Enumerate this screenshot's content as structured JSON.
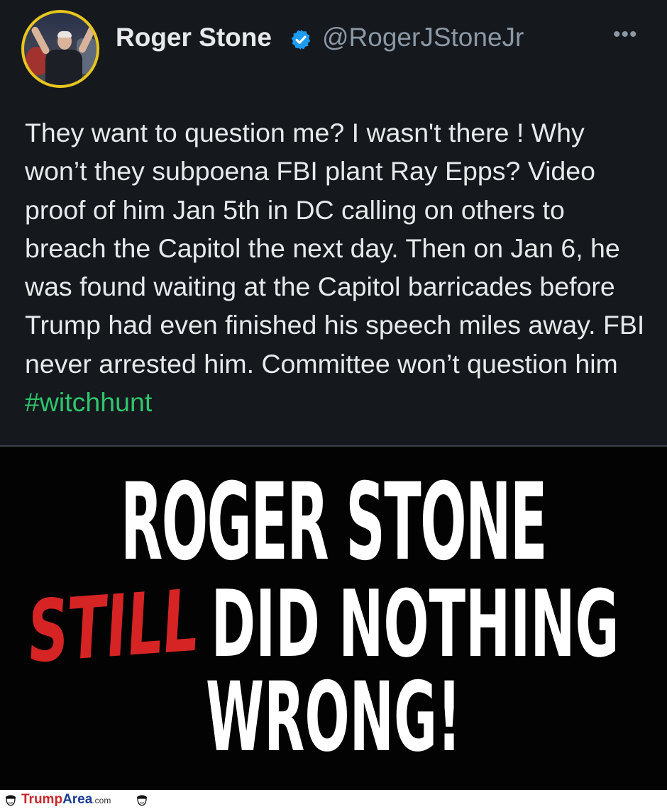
{
  "tweet": {
    "author_name": "Roger Stone",
    "handle": "@RogerJStoneJr",
    "more_icon": "more-icon",
    "verified_icon": "verified-badge-icon",
    "text_plain": "They want to question me? I wasn't there ! Why won’t they subpoena FBI plant Ray Epps? Video proof of him Jan 5th in DC calling on others to breach the Capitol the next day. Then on Jan 6, he was found waiting at the Capitol barricades before Trump had even finished his speech miles away. FBI never arrested him. Committee won’t question him ",
    "hashtag": "#witchhunt"
  },
  "banner": {
    "line1": "ROGER STONE",
    "still": "STILL",
    "line2": "DID NOTHING",
    "line3": "WRONG!"
  },
  "footer": {
    "brand_part1": "Trump",
    "brand_part2": "Area",
    "brand_part3": ".com"
  },
  "colors": {
    "background": "#15191e",
    "text": "#e7e9ea",
    "secondary": "#8b98a5",
    "hashtag": "#2fc56c",
    "verified": "#1d9bf0",
    "still_red": "#d62424",
    "avatar_ring": "#e8c51e"
  }
}
